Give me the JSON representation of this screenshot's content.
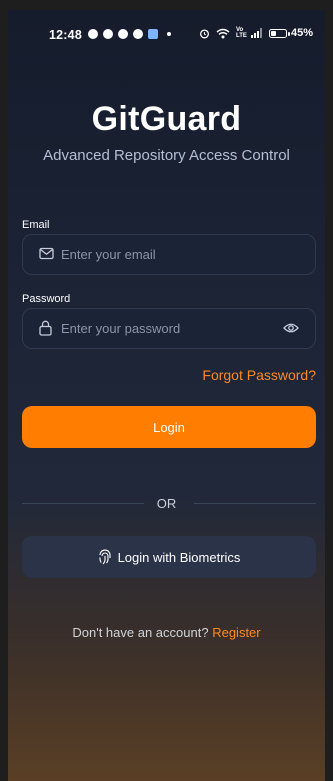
{
  "status_bar": {
    "time": "12:48",
    "network_label": "Vo LTE",
    "battery": "45%",
    "battery_level": 0.45
  },
  "app": {
    "title": "GitGuard",
    "subtitle": "Advanced Repository Access Control"
  },
  "form": {
    "email_label": "Email",
    "email_placeholder": "Enter your email",
    "password_label": "Password",
    "password_placeholder": "Enter your password",
    "forgot_link": "Forgot Password?",
    "login_button": "Login",
    "divider_text": "OR",
    "biometric_button": "Login with Biometrics"
  },
  "footer": {
    "prompt": "Don't have an account?",
    "register_link": "Register"
  },
  "colors": {
    "accent": "#ff7d00",
    "background_top": "#151c2c",
    "background_bottom": "#5a3f25",
    "field_bg": "#1b2336",
    "secondary_button": "#2a3347"
  }
}
